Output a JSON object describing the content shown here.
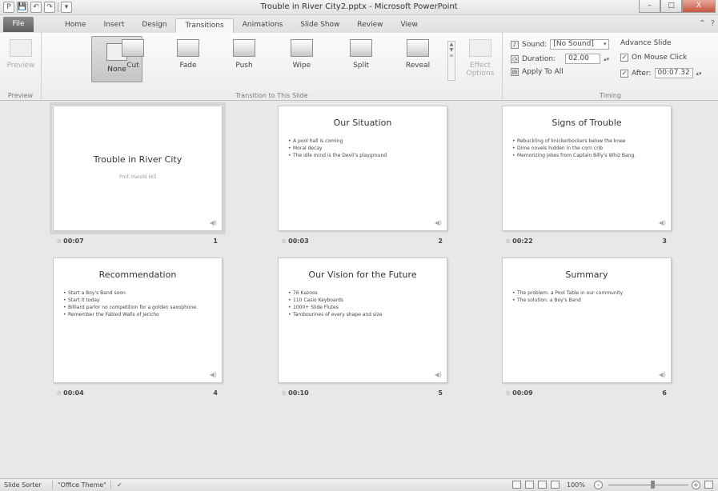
{
  "window": {
    "title": "Trouble in River City2.pptx - Microsoft PowerPoint",
    "minimize": "–",
    "maximize": "□",
    "close": "X"
  },
  "qat": {
    "app_icon": "P",
    "save": "💾",
    "undo": "↶",
    "redo": "↷",
    "customize": "▾"
  },
  "tabs": {
    "file": "File",
    "items": [
      "Home",
      "Insert",
      "Design",
      "Transitions",
      "Animations",
      "Slide Show",
      "Review",
      "View"
    ],
    "active": "Transitions"
  },
  "ribbon": {
    "preview": {
      "button": "Preview",
      "group": "Preview"
    },
    "transitions": {
      "group": "Transition to This Slide",
      "items": [
        "None",
        "Cut",
        "Fade",
        "Push",
        "Wipe",
        "Split",
        "Reveal"
      ],
      "selected": "None",
      "effect_options": "Effect Options"
    },
    "timing": {
      "group": "Timing",
      "sound_label": "Sound:",
      "sound_value": "[No Sound]",
      "duration_label": "Duration:",
      "duration_value": "02.00",
      "apply_all": "Apply To All",
      "advance_label": "Advance Slide",
      "on_mouse_click": "On Mouse Click",
      "on_mouse_click_checked": true,
      "after_label": "After:",
      "after_checked": true,
      "after_value": "00:07.32"
    }
  },
  "slides": [
    {
      "num": "1",
      "time": "00:07",
      "title": "Trouble in River City",
      "subtitle": "Prof. Harold Hill",
      "bullets": []
    },
    {
      "num": "2",
      "time": "00:03",
      "title": "Our Situation",
      "bullets": [
        "A pool hall is coming",
        "Moral decay",
        "The idle mind is the Devil's playground"
      ]
    },
    {
      "num": "3",
      "time": "00:22",
      "title": "Signs of Trouble",
      "bullets": [
        "Rebuckling of knickerbockers below the knee",
        "Dime novels hidden in the corn crib",
        "Memorizing jokes from Captain Billy's Whiz Bang."
      ]
    },
    {
      "num": "4",
      "time": "00:04",
      "title": "Recommendation",
      "bullets": [
        "Start a Boy's Band soon",
        "Start it today",
        "Billiard parlor no competition for a golden saxophone.",
        "Remember the Fabled Walls of Jericho"
      ]
    },
    {
      "num": "5",
      "time": "00:10",
      "title": "Our Vision for the Future",
      "bullets": [
        "76 Kazoos",
        "110 Casio Keyboards",
        "1000+ Slide Flutes",
        "Tambourines of every shape and size"
      ]
    },
    {
      "num": "6",
      "time": "00:09",
      "title": "Summary",
      "bullets": [
        "The problem: a Pool Table in our community",
        "The solution: a Boy's Band"
      ]
    }
  ],
  "statusbar": {
    "view": "Slide Sorter",
    "theme": "\"Office Theme\"",
    "zoom": "100%",
    "zoom_level": 0.55
  }
}
